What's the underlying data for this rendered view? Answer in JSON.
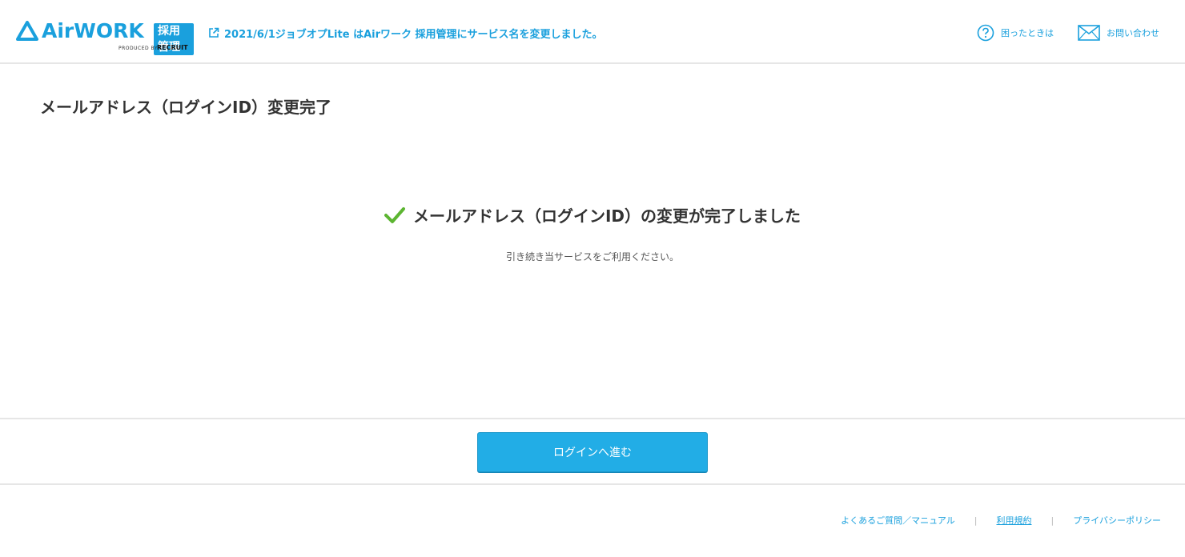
{
  "header": {
    "logo_text": "AirWORK",
    "logo_badge": "採用管理",
    "logo_produced_by": "PRODUCED BY",
    "logo_recruit": "RECRUIT",
    "notice": "2021/6/1ジョブオプLite はAirワーク 採用管理にサービス名を変更しました。",
    "help_label": "困ったときは",
    "contact_label": "お問い合わせ",
    "accent_color": "#1aa0dd"
  },
  "main": {
    "title": "メールアドレス（ログインID）変更完了",
    "complete_message": "メールアドレス（ログインID）の変更が完了しました",
    "sub_message": "引き続き当サービスをご利用ください。",
    "check_color": "#5cb531"
  },
  "actions": {
    "login_button_label": "ログインへ進む",
    "button_color": "#22ade6"
  },
  "footer": {
    "links": [
      {
        "label": "よくあるご質問／マニュアル"
      },
      {
        "label": "利用規約"
      },
      {
        "label": "プライバシーポリシー"
      }
    ],
    "separator": "|"
  }
}
